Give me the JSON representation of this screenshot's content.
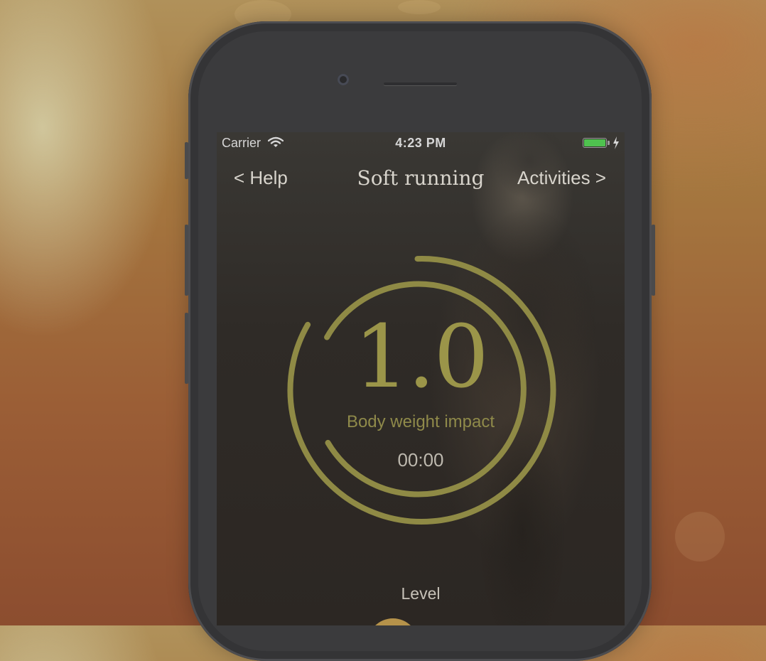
{
  "status_bar": {
    "carrier": "Carrier",
    "time": "4:23 PM",
    "battery_color": "#4fc24f",
    "wifi_icon": "wifi-icon",
    "charging_icon": "bolt-icon"
  },
  "nav": {
    "left_label": "< Help",
    "title": "Soft running",
    "right_label": "Activities >"
  },
  "gauge": {
    "value": "1.0",
    "caption": "Body weight impact",
    "timer": "00:00",
    "accent_color": "#8f8a45"
  },
  "level": {
    "label": "Level",
    "knob_color": "#b5924a"
  }
}
